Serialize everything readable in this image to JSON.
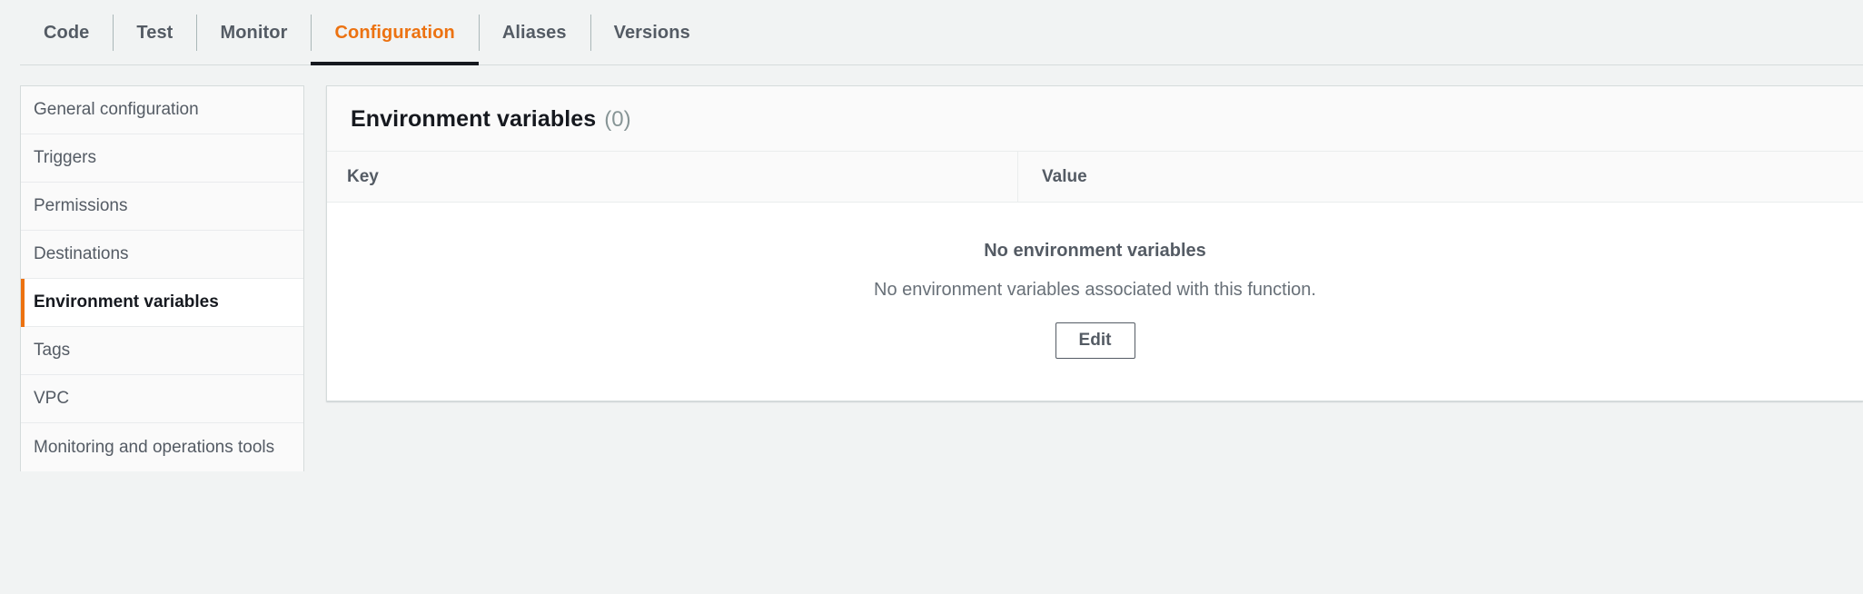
{
  "tabs": [
    {
      "label": "Code",
      "active": false
    },
    {
      "label": "Test",
      "active": false
    },
    {
      "label": "Monitor",
      "active": false
    },
    {
      "label": "Configuration",
      "active": true
    },
    {
      "label": "Aliases",
      "active": false
    },
    {
      "label": "Versions",
      "active": false
    }
  ],
  "sidebar": {
    "items": [
      {
        "label": "General configuration",
        "selected": false
      },
      {
        "label": "Triggers",
        "selected": false
      },
      {
        "label": "Permissions",
        "selected": false
      },
      {
        "label": "Destinations",
        "selected": false
      },
      {
        "label": "Environment variables",
        "selected": true
      },
      {
        "label": "Tags",
        "selected": false
      },
      {
        "label": "VPC",
        "selected": false
      },
      {
        "label": "Monitoring and operations tools",
        "selected": false
      }
    ]
  },
  "panel": {
    "title": "Environment variables",
    "count": "(0)",
    "columns": [
      {
        "label": "Key"
      },
      {
        "label": "Value"
      }
    ],
    "rows": [],
    "empty": {
      "title": "No environment variables",
      "description": "No environment variables associated with this function.",
      "action_label": "Edit"
    }
  },
  "colors": {
    "accent_orange": "#ec7211",
    "active_tab_underline": "#16191f",
    "text_primary": "#16191f",
    "text_secondary": "#545b64",
    "text_muted": "#879596",
    "page_background": "#f1f3f3",
    "panel_background": "#ffffff",
    "panel_header_background": "#fafafa",
    "border": "#d5dbdb"
  }
}
